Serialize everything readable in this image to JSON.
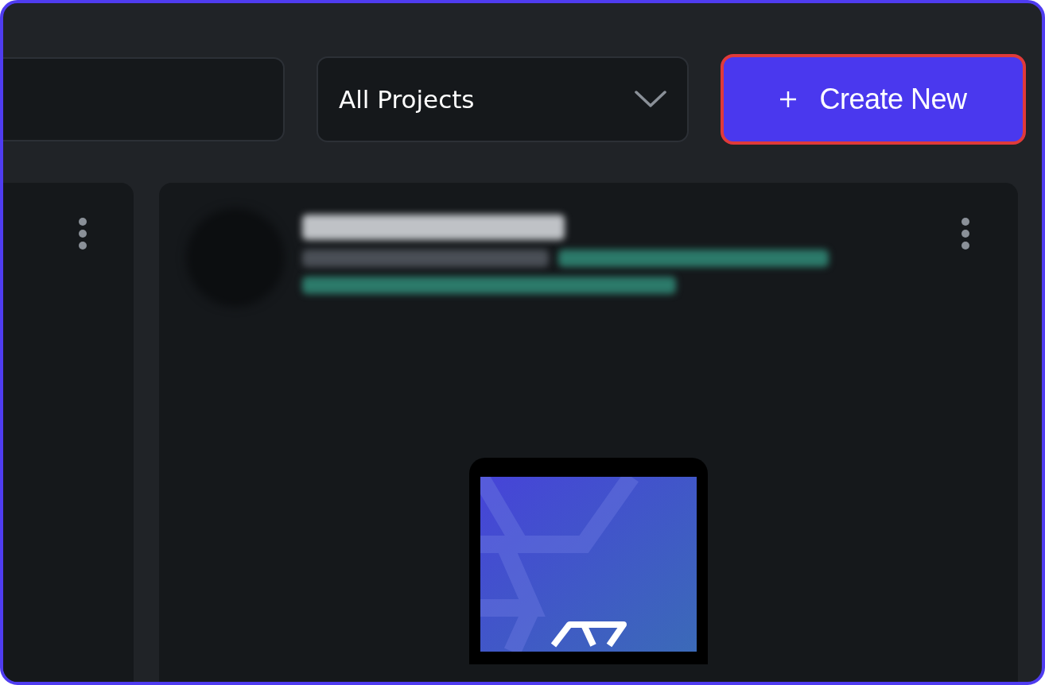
{
  "toolbar": {
    "project_filter": {
      "value": "All Projects"
    },
    "create_button": {
      "label": "Create New",
      "highlighted": true
    }
  }
}
